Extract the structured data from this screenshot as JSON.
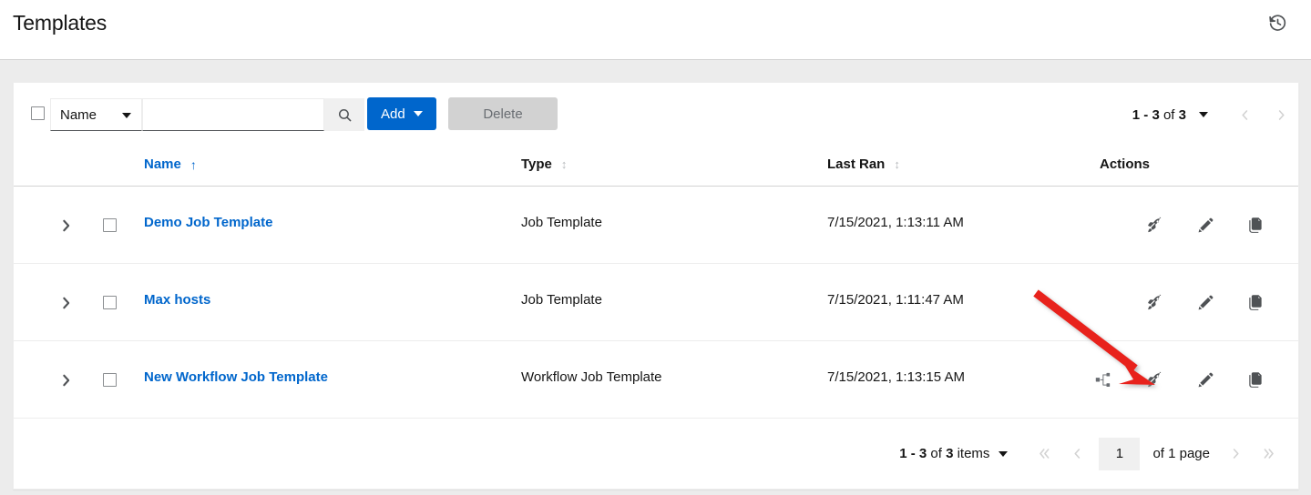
{
  "header": {
    "title": "Templates",
    "history_icon": "history-icon"
  },
  "toolbar": {
    "select_all_checkbox": "",
    "filter_label": "Name",
    "search_value": "",
    "search_placeholder": "",
    "search_icon": "search-icon",
    "add_label": "Add",
    "delete_label": "Delete",
    "add_color": "#0066cc",
    "delete_color": "#d2d2d2"
  },
  "top_pagination": {
    "range_start": "1 - 3",
    "of_word": " of ",
    "total": "3",
    "prev_icon": "chevron-left-icon",
    "next_icon": "chevron-right-icon"
  },
  "table": {
    "columns": [
      {
        "label": "Name",
        "sort": "asc",
        "sort_icon": "sort-asc-icon"
      },
      {
        "label": "Type",
        "sort": "none",
        "sort_icon": "sort-both-icon"
      },
      {
        "label": "Last Ran",
        "sort": "none",
        "sort_icon": "sort-both-icon"
      },
      {
        "label": "Actions",
        "sort": null,
        "sort_icon": null
      }
    ],
    "rows": [
      {
        "name": "Demo Job Template",
        "type": "Job Template",
        "last_ran": "7/15/2021, 1:13:11 AM",
        "actions": [
          "launch-icon",
          "edit-icon",
          "copy-icon"
        ]
      },
      {
        "name": "Max hosts",
        "type": "Job Template",
        "last_ran": "7/15/2021, 1:11:47 AM",
        "actions": [
          "launch-icon",
          "edit-icon",
          "copy-icon"
        ]
      },
      {
        "name": "New Workflow Job Template",
        "type": "Workflow Job Template",
        "last_ran": "7/15/2021, 1:13:15 AM",
        "actions": [
          "workflow-visualizer-icon",
          "launch-icon",
          "edit-icon",
          "copy-icon"
        ]
      }
    ]
  },
  "bottom_pagination": {
    "range_start": "1 - 3",
    "of_word": " of ",
    "total": "3",
    "items_word": " items",
    "first_icon": "angle-double-left-icon",
    "prev_icon": "chevron-left-icon",
    "page_value": "1",
    "of_pages": "of 1 page",
    "next_icon": "chevron-right-icon",
    "last_icon": "angle-double-right-icon"
  },
  "annotation": {
    "arrow_color": "#e8221a",
    "points_at": "launch-icon-row-3"
  },
  "colors": {
    "link": "#0066cc",
    "page_bg": "#ececec",
    "card_bg": "#ffffff",
    "text": "#151515"
  }
}
